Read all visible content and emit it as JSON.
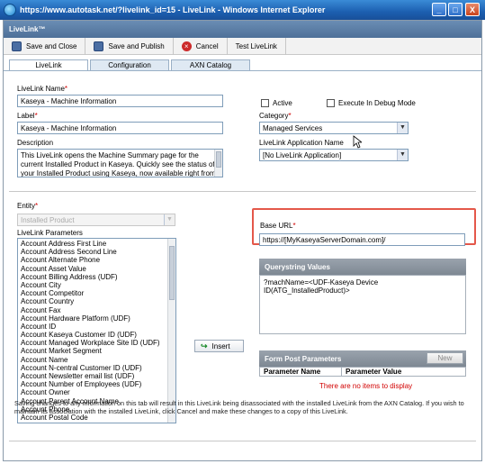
{
  "window": {
    "title": "https://www.autotask.net/?livelink_id=15 - LiveLink - Windows Internet Explorer",
    "controls": [
      "_",
      "□",
      "X"
    ]
  },
  "app": {
    "header": "LiveLink™"
  },
  "toolbar": {
    "save_and_close": "Save and Close",
    "save_and_publish": "Save and Publish",
    "cancel": "Cancel",
    "test_livelink": "Test LiveLink"
  },
  "tabs": [
    "LiveLink",
    "Configuration",
    "AXN Catalog"
  ],
  "form": {
    "livelink_name_label": "LiveLink Name",
    "livelink_name_value": "Kaseya - Machine Information",
    "label_label": "Label",
    "label_value": "Kaseya - Machine Information",
    "description_label": "Description",
    "description_value": "This LiveLink opens the Machine Summary page for the current Installed Product in Kaseya.  Quickly see the status of your Installed Product using Kaseya, now available right from Autotask.",
    "active_label": "Active",
    "debug_label": "Execute In Debug Mode",
    "category_label": "Category",
    "category_value": "Managed Services",
    "app_name_label": "LiveLink Application Name",
    "app_name_value": "[No LiveLink Application]",
    "required_mark": "*"
  },
  "entity": {
    "label": "Entity",
    "value": "Installed Product",
    "params_label": "LiveLink Parameters",
    "params": [
      "Account Address First Line",
      "Account Address Second Line",
      "Account Alternate Phone",
      "Account Asset Value",
      "Account Billing Address (UDF)",
      "Account City",
      "Account Competitor",
      "Account Country",
      "Account Fax",
      "Account Hardware Platform (UDF)",
      "Account ID",
      "Account Kaseya Customer ID (UDF)",
      "Account Managed Workplace Site ID (UDF)",
      "Account Market Segment",
      "Account Name",
      "Account N-central Customer ID (UDF)",
      "Account Newsletter email list (UDF)",
      "Account Number of Employees (UDF)",
      "Account Owner",
      "Account Parent Account Name",
      "Account Phone",
      "Account Postal Code"
    ],
    "insert_button": "Insert"
  },
  "base_url": {
    "label": "Base URL",
    "value": "https://[MyKaseyaServerDomain.com]/"
  },
  "querystring": {
    "header": "Querystring Values",
    "value": "?machName=<UDF-Kaseya Device ID(ATG_InstalledProduct)>"
  },
  "form_post": {
    "header": "Form Post Parameters",
    "new_button": "New",
    "col_name": "Parameter Name",
    "col_value": "Parameter Value",
    "empty_text": "There are no items to display"
  },
  "footer": {
    "text": "Saving changes to any information on this tab will result in this LiveLink being disassociated with the installed LiveLink from the AXN Catalog. If you wish to maintain its association with the installed LiveLink, click Cancel and make these changes to a copy of this LiveLink."
  },
  "colors": {
    "title_bar": "#1c5fb0",
    "app_header": "#5a7ea6",
    "required": "#d10000",
    "highlight_box": "#e4584a"
  }
}
